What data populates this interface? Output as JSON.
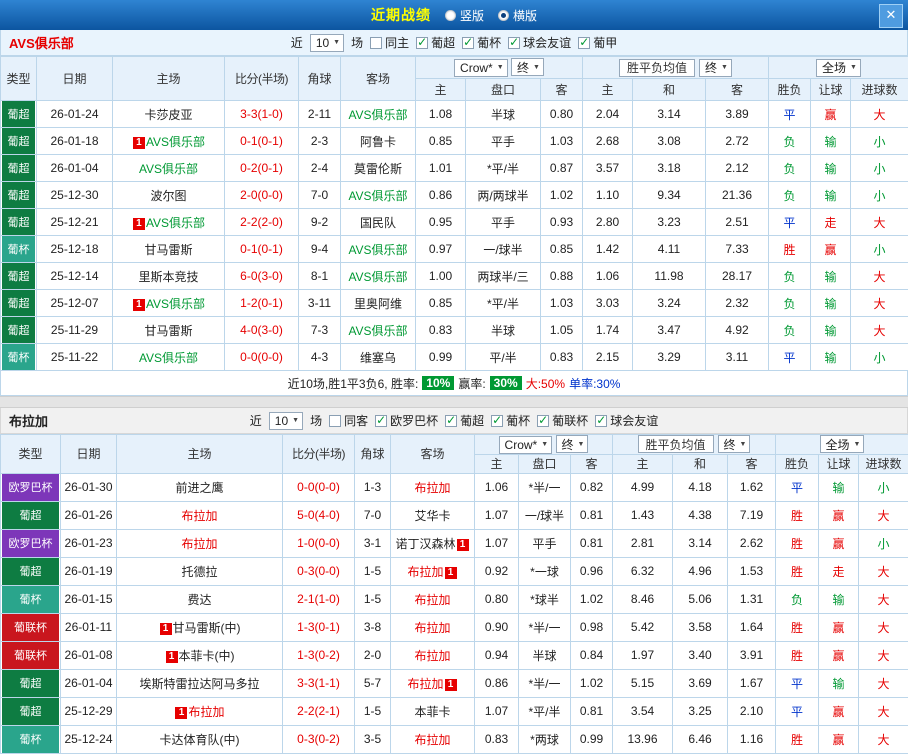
{
  "titlebar": {
    "title": "近期战绩",
    "radio_vertical": "竖版",
    "radio_horizontal": "横版",
    "close": "✕"
  },
  "controls": {
    "near": "近",
    "rounds": "10",
    "matches": "场",
    "bookmaker": "Crow*",
    "final": "终",
    "euro_avg": "胜平负均值",
    "scope": "全场"
  },
  "columns": {
    "type": "类型",
    "date": "日期",
    "home": "主场",
    "score": "比分(半场)",
    "corner": "角球",
    "away": "客场",
    "asian_home": "主",
    "handicap": "盘口",
    "asian_away": "客",
    "euro_home": "主",
    "euro_draw": "和",
    "euro_away": "客",
    "wdl": "胜负",
    "handicap_result": "让球",
    "goals": "进球数"
  },
  "type_colors": {
    "pc": "#0E7C42",
    "pb": "#2AA58C",
    "el": "#7D36B9",
    "pl": "#C9161E"
  },
  "result_colors": {
    "red": "#E60000",
    "green": "#009933",
    "blue": "#0033CC"
  },
  "sections": [
    {
      "key": "avs",
      "team": "AVS俱乐部",
      "team_style": "red",
      "filters": [
        {
          "label": "同主",
          "checked": false
        },
        {
          "label": "葡超",
          "checked": true
        },
        {
          "label": "葡杯",
          "checked": true
        },
        {
          "label": "球会友谊",
          "checked": true
        },
        {
          "label": "葡甲",
          "checked": true
        }
      ],
      "rows": [
        {
          "type": "葡超",
          "tk": "pc",
          "date": "26-01-24",
          "home": "卡莎皮亚",
          "homeColor": "",
          "homeBadge": "",
          "score": "3-3(1-0)",
          "corners": "2-11",
          "away": "AVS俱乐部",
          "awayColor": "green",
          "awayBadge": "",
          "asianHome": "1.08",
          "handicap": "半球",
          "asianAway": "0.80",
          "euroHome": "2.04",
          "euroDraw": "3.14",
          "euroAway": "3.89",
          "wdl": "平",
          "wdlColor": "blue",
          "letgoal": "赢",
          "letgoalColor": "red",
          "goals": "大",
          "goalsColor": "red"
        },
        {
          "type": "葡超",
          "tk": "pc",
          "date": "26-01-18",
          "home": "AVS俱乐部",
          "homeColor": "green",
          "homeBadge": "before",
          "score": "0-1(0-1)",
          "corners": "2-3",
          "away": "阿鲁卡",
          "awayColor": "",
          "awayBadge": "",
          "asianHome": "0.85",
          "handicap": "平手",
          "asianAway": "1.03",
          "euroHome": "2.68",
          "euroDraw": "3.08",
          "euroAway": "2.72",
          "wdl": "负",
          "wdlColor": "green",
          "letgoal": "输",
          "letgoalColor": "green",
          "goals": "小",
          "goalsColor": "green"
        },
        {
          "type": "葡超",
          "tk": "pc",
          "date": "26-01-04",
          "home": "AVS俱乐部",
          "homeColor": "green",
          "homeBadge": "",
          "score": "0-2(0-1)",
          "corners": "2-4",
          "away": "莫雷伦斯",
          "awayColor": "",
          "awayBadge": "",
          "asianHome": "1.01",
          "handicap": "*平/半",
          "asianAway": "0.87",
          "euroHome": "3.57",
          "euroDraw": "3.18",
          "euroAway": "2.12",
          "wdl": "负",
          "wdlColor": "green",
          "letgoal": "输",
          "letgoalColor": "green",
          "goals": "小",
          "goalsColor": "green"
        },
        {
          "type": "葡超",
          "tk": "pc",
          "date": "25-12-30",
          "home": "波尔图",
          "homeColor": "",
          "homeBadge": "",
          "score": "2-0(0-0)",
          "corners": "7-0",
          "away": "AVS俱乐部",
          "awayColor": "green",
          "awayBadge": "",
          "asianHome": "0.86",
          "handicap": "两/两球半",
          "asianAway": "1.02",
          "euroHome": "1.10",
          "euroDraw": "9.34",
          "euroAway": "21.36",
          "wdl": "负",
          "wdlColor": "green",
          "letgoal": "输",
          "letgoalColor": "green",
          "goals": "小",
          "goalsColor": "green"
        },
        {
          "type": "葡超",
          "tk": "pc",
          "date": "25-12-21",
          "home": "AVS俱乐部",
          "homeColor": "green",
          "homeBadge": "before",
          "score": "2-2(2-0)",
          "corners": "9-2",
          "away": "国民队",
          "awayColor": "",
          "awayBadge": "",
          "asianHome": "0.95",
          "handicap": "平手",
          "asianAway": "0.93",
          "euroHome": "2.80",
          "euroDraw": "3.23",
          "euroAway": "2.51",
          "wdl": "平",
          "wdlColor": "blue",
          "letgoal": "走",
          "letgoalColor": "red",
          "goals": "大",
          "goalsColor": "red"
        },
        {
          "type": "葡杯",
          "tk": "pb",
          "date": "25-12-18",
          "home": "甘马雷斯",
          "homeColor": "",
          "homeBadge": "",
          "score": "0-1(0-1)",
          "corners": "9-4",
          "away": "AVS俱乐部",
          "awayColor": "green",
          "awayBadge": "",
          "asianHome": "0.97",
          "handicap": "一/球半",
          "asianAway": "0.85",
          "euroHome": "1.42",
          "euroDraw": "4.11",
          "euroAway": "7.33",
          "wdl": "胜",
          "wdlColor": "red",
          "letgoal": "赢",
          "letgoalColor": "red",
          "goals": "小",
          "goalsColor": "green"
        },
        {
          "type": "葡超",
          "tk": "pc",
          "date": "25-12-14",
          "home": "里斯本竞技",
          "homeColor": "",
          "homeBadge": "",
          "score": "6-0(3-0)",
          "corners": "8-1",
          "away": "AVS俱乐部",
          "awayColor": "green",
          "awayBadge": "",
          "asianHome": "1.00",
          "handicap": "两球半/三",
          "asianAway": "0.88",
          "euroHome": "1.06",
          "euroDraw": "11.98",
          "euroAway": "28.17",
          "wdl": "负",
          "wdlColor": "green",
          "letgoal": "输",
          "letgoalColor": "green",
          "goals": "大",
          "goalsColor": "red"
        },
        {
          "type": "葡超",
          "tk": "pc",
          "date": "25-12-07",
          "home": "AVS俱乐部",
          "homeColor": "green",
          "homeBadge": "before",
          "score": "1-2(0-1)",
          "corners": "3-11",
          "away": "里奥阿维",
          "awayColor": "",
          "awayBadge": "",
          "asianHome": "0.85",
          "handicap": "*平/半",
          "asianAway": "1.03",
          "euroHome": "3.03",
          "euroDraw": "3.24",
          "euroAway": "2.32",
          "wdl": "负",
          "wdlColor": "green",
          "letgoal": "输",
          "letgoalColor": "green",
          "goals": "大",
          "goalsColor": "red"
        },
        {
          "type": "葡超",
          "tk": "pc",
          "date": "25-11-29",
          "home": "甘马雷斯",
          "homeColor": "",
          "homeBadge": "",
          "score": "4-0(3-0)",
          "corners": "7-3",
          "away": "AVS俱乐部",
          "awayColor": "green",
          "awayBadge": "",
          "asianHome": "0.83",
          "handicap": "半球",
          "asianAway": "1.05",
          "euroHome": "1.74",
          "euroDraw": "3.47",
          "euroAway": "4.92",
          "wdl": "负",
          "wdlColor": "green",
          "letgoal": "输",
          "letgoalColor": "green",
          "goals": "大",
          "goalsColor": "red"
        },
        {
          "type": "葡杯",
          "tk": "pb",
          "date": "25-11-22",
          "home": "AVS俱乐部",
          "homeColor": "green",
          "homeBadge": "",
          "score": "0-0(0-0)",
          "corners": "4-3",
          "away": "维塞乌",
          "awayColor": "",
          "awayBadge": "",
          "asianHome": "0.99",
          "handicap": "平/半",
          "asianAway": "0.83",
          "euroHome": "2.15",
          "euroDraw": "3.29",
          "euroAway": "3.11",
          "wdl": "平",
          "wdlColor": "blue",
          "letgoal": "输",
          "letgoalColor": "green",
          "goals": "小",
          "goalsColor": "green"
        }
      ],
      "summary": [
        {
          "text": "近10场,胜1平3负6, 胜率:",
          "cls": "plain"
        },
        {
          "text": "10%",
          "cls": "badge"
        },
        {
          "text": "赢率:",
          "cls": "plain"
        },
        {
          "text": "30%",
          "cls": "badge"
        },
        {
          "text": "大:50%",
          "cls": "red"
        },
        {
          "text": "单率:30%",
          "cls": "blue"
        }
      ]
    },
    {
      "key": "braga",
      "team": "布拉加",
      "team_style": "dark",
      "filters": [
        {
          "label": "同客",
          "checked": false
        },
        {
          "label": "欧罗巴杯",
          "checked": true
        },
        {
          "label": "葡超",
          "checked": true
        },
        {
          "label": "葡杯",
          "checked": true
        },
        {
          "label": "葡联杯",
          "checked": true
        },
        {
          "label": "球会友谊",
          "checked": true
        }
      ],
      "rows": [
        {
          "type": "欧罗巴杯",
          "tk": "el",
          "date": "26-01-30",
          "home": "前进之鹰",
          "homeColor": "",
          "homeBadge": "",
          "score": "0-0(0-0)",
          "corners": "1-3",
          "away": "布拉加",
          "awayColor": "red",
          "awayBadge": "",
          "asianHome": "1.06",
          "handicap": "*半/一",
          "asianAway": "0.82",
          "euroHome": "4.99",
          "euroDraw": "4.18",
          "euroAway": "1.62",
          "wdl": "平",
          "wdlColor": "blue",
          "letgoal": "输",
          "letgoalColor": "green",
          "goals": "小",
          "goalsColor": "green"
        },
        {
          "type": "葡超",
          "tk": "pc",
          "date": "26-01-26",
          "home": "布拉加",
          "homeColor": "red",
          "homeBadge": "",
          "score": "5-0(4-0)",
          "corners": "7-0",
          "away": "艾华卡",
          "awayColor": "",
          "awayBadge": "",
          "asianHome": "1.07",
          "handicap": "一/球半",
          "asianAway": "0.81",
          "euroHome": "1.43",
          "euroDraw": "4.38",
          "euroAway": "7.19",
          "wdl": "胜",
          "wdlColor": "red",
          "letgoal": "赢",
          "letgoalColor": "red",
          "goals": "大",
          "goalsColor": "red"
        },
        {
          "type": "欧罗巴杯",
          "tk": "el",
          "date": "26-01-23",
          "home": "布拉加",
          "homeColor": "red",
          "homeBadge": "",
          "score": "1-0(0-0)",
          "corners": "3-1",
          "away": "诺丁汉森林",
          "awayColor": "",
          "awayBadge": "after",
          "asianHome": "1.07",
          "handicap": "平手",
          "asianAway": "0.81",
          "euroHome": "2.81",
          "euroDraw": "3.14",
          "euroAway": "2.62",
          "wdl": "胜",
          "wdlColor": "red",
          "letgoal": "赢",
          "letgoalColor": "red",
          "goals": "小",
          "goalsColor": "green"
        },
        {
          "type": "葡超",
          "tk": "pc",
          "date": "26-01-19",
          "home": "托德拉",
          "homeColor": "",
          "homeBadge": "",
          "score": "0-3(0-0)",
          "corners": "1-5",
          "away": "布拉加",
          "awayColor": "red",
          "awayBadge": "after",
          "asianHome": "0.92",
          "handicap": "*一球",
          "asianAway": "0.96",
          "euroHome": "6.32",
          "euroDraw": "4.96",
          "euroAway": "1.53",
          "wdl": "胜",
          "wdlColor": "red",
          "letgoal": "走",
          "letgoalColor": "red",
          "goals": "大",
          "goalsColor": "red"
        },
        {
          "type": "葡杯",
          "tk": "pb",
          "date": "26-01-15",
          "home": "费达",
          "homeColor": "",
          "homeBadge": "",
          "score": "2-1(1-0)",
          "corners": "1-5",
          "away": "布拉加",
          "awayColor": "red",
          "awayBadge": "",
          "asianHome": "0.80",
          "handicap": "*球半",
          "asianAway": "1.02",
          "euroHome": "8.46",
          "euroDraw": "5.06",
          "euroAway": "1.31",
          "wdl": "负",
          "wdlColor": "green",
          "letgoal": "输",
          "letgoalColor": "green",
          "goals": "大",
          "goalsColor": "red"
        },
        {
          "type": "葡联杯",
          "tk": "pl",
          "date": "26-01-11",
          "home": "甘马雷斯(中)",
          "homeColor": "",
          "homeBadge": "before",
          "score": "1-3(0-1)",
          "corners": "3-8",
          "away": "布拉加",
          "awayColor": "red",
          "awayBadge": "",
          "asianHome": "0.90",
          "handicap": "*半/一",
          "asianAway": "0.98",
          "euroHome": "5.42",
          "euroDraw": "3.58",
          "euroAway": "1.64",
          "wdl": "胜",
          "wdlColor": "red",
          "letgoal": "赢",
          "letgoalColor": "red",
          "goals": "大",
          "goalsColor": "red"
        },
        {
          "type": "葡联杯",
          "tk": "pl",
          "date": "26-01-08",
          "home": "本菲卡(中)",
          "homeColor": "",
          "homeBadge": "before",
          "score": "1-3(0-2)",
          "corners": "2-0",
          "away": "布拉加",
          "awayColor": "red",
          "awayBadge": "",
          "asianHome": "0.94",
          "handicap": "半球",
          "asianAway": "0.84",
          "euroHome": "1.97",
          "euroDraw": "3.40",
          "euroAway": "3.91",
          "wdl": "胜",
          "wdlColor": "red",
          "letgoal": "赢",
          "letgoalColor": "red",
          "goals": "大",
          "goalsColor": "red"
        },
        {
          "type": "葡超",
          "tk": "pc",
          "date": "26-01-04",
          "home": "埃斯特雷拉达阿马多拉",
          "homeColor": "",
          "homeBadge": "",
          "score": "3-3(1-1)",
          "corners": "5-7",
          "away": "布拉加",
          "awayColor": "red",
          "awayBadge": "after",
          "asianHome": "0.86",
          "handicap": "*半/一",
          "asianAway": "1.02",
          "euroHome": "5.15",
          "euroDraw": "3.69",
          "euroAway": "1.67",
          "wdl": "平",
          "wdlColor": "blue",
          "letgoal": "输",
          "letgoalColor": "green",
          "goals": "大",
          "goalsColor": "red"
        },
        {
          "type": "葡超",
          "tk": "pc",
          "date": "25-12-29",
          "home": "布拉加",
          "homeColor": "red",
          "homeBadge": "before",
          "score": "2-2(2-1)",
          "corners": "1-5",
          "away": "本菲卡",
          "awayColor": "",
          "awayBadge": "",
          "asianHome": "1.07",
          "handicap": "*平/半",
          "asianAway": "0.81",
          "euroHome": "3.54",
          "euroDraw": "3.25",
          "euroAway": "2.10",
          "wdl": "平",
          "wdlColor": "blue",
          "letgoal": "赢",
          "letgoalColor": "red",
          "goals": "大",
          "goalsColor": "red"
        },
        {
          "type": "葡杯",
          "tk": "pb",
          "date": "25-12-24",
          "home": "卡达体育队(中)",
          "homeColor": "",
          "homeBadge": "",
          "score": "0-3(0-2)",
          "corners": "3-5",
          "away": "布拉加",
          "awayColor": "red",
          "awayBadge": "",
          "asianHome": "0.83",
          "handicap": "*两球",
          "asianAway": "0.99",
          "euroHome": "13.96",
          "euroDraw": "6.46",
          "euroAway": "1.16",
          "wdl": "胜",
          "wdlColor": "red",
          "letgoal": "赢",
          "letgoalColor": "red",
          "goals": "大",
          "goalsColor": "red"
        }
      ]
    }
  ]
}
